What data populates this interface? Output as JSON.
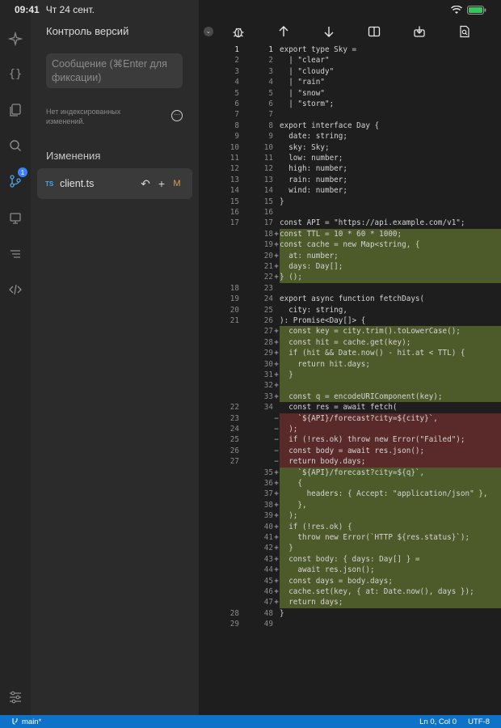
{
  "status": {
    "time": "09:41",
    "date": "Чт 24 сент."
  },
  "sidebar": {
    "title": "Контроль версий",
    "commit_placeholder": "Сообщение (⌘Enter для фиксации)",
    "no_changes": "Нет индексированных изменений.",
    "changes_title": "Изменения",
    "badge_count": "1",
    "file": {
      "type": "TS",
      "name": "client.ts",
      "status": "M"
    }
  },
  "footer": {
    "branch": "main*",
    "position": "Ln 0, Col 0",
    "encoding": "UTF-8"
  },
  "code_lines": [
    {
      "l": "1",
      "r": "1",
      "m": "",
      "t": "n",
      "c": "export type Sky ="
    },
    {
      "l": "2",
      "r": "2",
      "m": "",
      "t": "n",
      "c": "  | \"clear\""
    },
    {
      "l": "3",
      "r": "3",
      "m": "",
      "t": "n",
      "c": "  | \"cloudy\""
    },
    {
      "l": "4",
      "r": "4",
      "m": "",
      "t": "n",
      "c": "  | \"rain\""
    },
    {
      "l": "5",
      "r": "5",
      "m": "",
      "t": "n",
      "c": "  | \"snow\""
    },
    {
      "l": "6",
      "r": "6",
      "m": "",
      "t": "n",
      "c": "  | \"storm\";"
    },
    {
      "l": "7",
      "r": "7",
      "m": "",
      "t": "n",
      "c": ""
    },
    {
      "l": "8",
      "r": "8",
      "m": "",
      "t": "n",
      "c": "export interface Day {"
    },
    {
      "l": "9",
      "r": "9",
      "m": "",
      "t": "n",
      "c": "  date: string;"
    },
    {
      "l": "10",
      "r": "10",
      "m": "",
      "t": "n",
      "c": "  sky: Sky;"
    },
    {
      "l": "11",
      "r": "11",
      "m": "",
      "t": "n",
      "c": "  low: number;"
    },
    {
      "l": "12",
      "r": "12",
      "m": "",
      "t": "n",
      "c": "  high: number;"
    },
    {
      "l": "13",
      "r": "13",
      "m": "",
      "t": "n",
      "c": "  rain: number;"
    },
    {
      "l": "14",
      "r": "14",
      "m": "",
      "t": "n",
      "c": "  wind: number;"
    },
    {
      "l": "15",
      "r": "15",
      "m": "",
      "t": "n",
      "c": "}"
    },
    {
      "l": "16",
      "r": "16",
      "m": "",
      "t": "n",
      "c": ""
    },
    {
      "l": "17",
      "r": "17",
      "m": "",
      "t": "n",
      "c": "const API = \"https://api.example.com/v1\";"
    },
    {
      "l": "",
      "r": "18",
      "m": "+",
      "t": "a",
      "c": "const TTL = 10 * 60 * 1000;"
    },
    {
      "l": "",
      "r": "19",
      "m": "+",
      "t": "a",
      "c": "const cache = new Map<string, {"
    },
    {
      "l": "",
      "r": "20",
      "m": "+",
      "t": "a",
      "c": "  at: number;"
    },
    {
      "l": "",
      "r": "21",
      "m": "+",
      "t": "a",
      "c": "  days: Day[];"
    },
    {
      "l": "",
      "r": "22",
      "m": "+",
      "t": "a",
      "c": "} ();"
    },
    {
      "l": "18",
      "r": "23",
      "m": "",
      "t": "n",
      "c": ""
    },
    {
      "l": "19",
      "r": "24",
      "m": "",
      "t": "n",
      "c": "export async function fetchDays("
    },
    {
      "l": "20",
      "r": "25",
      "m": "",
      "t": "n",
      "c": "  city: string,"
    },
    {
      "l": "21",
      "r": "26",
      "m": "",
      "t": "n",
      "c": "): Promise<Day[]> {"
    },
    {
      "l": "",
      "r": "27",
      "m": "+",
      "t": "a",
      "c": "  const key = city.trim().toLowerCase();"
    },
    {
      "l": "",
      "r": "28",
      "m": "+",
      "t": "a",
      "c": "  const hit = cache.get(key);"
    },
    {
      "l": "",
      "r": "29",
      "m": "+",
      "t": "a",
      "c": "  if (hit && Date.now() - hit.at < TTL) {"
    },
    {
      "l": "",
      "r": "30",
      "m": "+",
      "t": "a",
      "c": "    return hit.days;"
    },
    {
      "l": "",
      "r": "31",
      "m": "+",
      "t": "a",
      "c": "  }"
    },
    {
      "l": "",
      "r": "32",
      "m": "+",
      "t": "a",
      "c": ""
    },
    {
      "l": "",
      "r": "33",
      "m": "+",
      "t": "a",
      "c": "  const q = encodeURIComponent(key);"
    },
    {
      "l": "22",
      "r": "34",
      "m": "",
      "t": "n",
      "c": "  const res = await fetch("
    },
    {
      "l": "23",
      "r": "",
      "m": "−",
      "t": "d",
      "c": "    `${API}/forecast?city=${city}`,"
    },
    {
      "l": "24",
      "r": "",
      "m": "−",
      "t": "d",
      "c": "  );"
    },
    {
      "l": "25",
      "r": "",
      "m": "−",
      "t": "d",
      "c": "  if (!res.ok) throw new Error(\"Failed\");"
    },
    {
      "l": "26",
      "r": "",
      "m": "−",
      "t": "d",
      "c": "  const body = await res.json();"
    },
    {
      "l": "27",
      "r": "",
      "m": "−",
      "t": "d",
      "c": "  return body.days;"
    },
    {
      "l": "",
      "r": "35",
      "m": "+",
      "t": "a",
      "c": "    `${API}/forecast?city=${q}`,"
    },
    {
      "l": "",
      "r": "36",
      "m": "+",
      "t": "a",
      "c": "    {"
    },
    {
      "l": "",
      "r": "37",
      "m": "+",
      "t": "a",
      "c": "      headers: { Accept: \"application/json\" },"
    },
    {
      "l": "",
      "r": "38",
      "m": "+",
      "t": "a",
      "c": "    },"
    },
    {
      "l": "",
      "r": "39",
      "m": "+",
      "t": "a",
      "c": "  );"
    },
    {
      "l": "",
      "r": "40",
      "m": "+",
      "t": "a",
      "c": "  if (!res.ok) {"
    },
    {
      "l": "",
      "r": "41",
      "m": "+",
      "t": "a",
      "c": "    throw new Error(`HTTP ${res.status}`);"
    },
    {
      "l": "",
      "r": "42",
      "m": "+",
      "t": "a",
      "c": "  }"
    },
    {
      "l": "",
      "r": "43",
      "m": "+",
      "t": "a",
      "c": "  const body: { days: Day[] } ="
    },
    {
      "l": "",
      "r": "44",
      "m": "+",
      "t": "a",
      "c": "    await res.json();"
    },
    {
      "l": "",
      "r": "45",
      "m": "+",
      "t": "a",
      "c": "  const days = body.days;"
    },
    {
      "l": "",
      "r": "46",
      "m": "+",
      "t": "a",
      "c": "  cache.set(key, { at: Date.now(), days });"
    },
    {
      "l": "",
      "r": "47",
      "m": "+",
      "t": "a",
      "c": "  return days;"
    },
    {
      "l": "28",
      "r": "48",
      "m": "",
      "t": "n",
      "c": "}"
    },
    {
      "l": "29",
      "r": "49",
      "m": "",
      "t": "n",
      "c": ""
    }
  ],
  "colors": {
    "accent": "#0e73c8",
    "added": "#4d5a2a",
    "deleted": "#5a2a2a",
    "modified": "#d9a04a"
  }
}
